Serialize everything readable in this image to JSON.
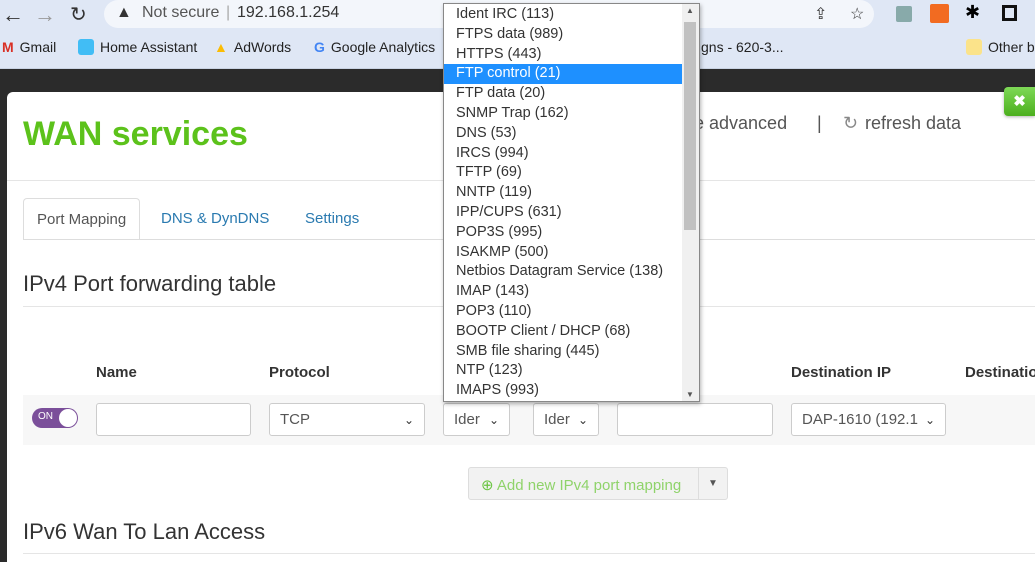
{
  "browser": {
    "security": "Not secure",
    "url": "192.168.1.254",
    "bookmarks": [
      "Gmail",
      "Home Assistant",
      "AdWords",
      "Google Analytics",
      "gns - 620-3...",
      "Other b"
    ]
  },
  "header": {
    "title": "WAN services",
    "toggle_advanced": "le advanced",
    "separator": "|",
    "refresh": "refresh data",
    "close": "✖"
  },
  "tabs": [
    "Port Mapping",
    "DNS & DynDNS",
    "Settings"
  ],
  "ipv4": {
    "heading": "IPv4 Port forwarding table",
    "columns": [
      "Name",
      "Protocol",
      "Destination IP",
      "Destinatio"
    ],
    "row": {
      "toggle": "ON",
      "name": "",
      "protocol": "TCP",
      "ext_port": "Ider",
      "int_port": "Ider",
      "other": "",
      "dest_ip": "DAP-1610 (192.1"
    },
    "add_button": "Add new IPv4 port mapping"
  },
  "ipv6": {
    "heading": "IPv6 Wan To Lan Access"
  },
  "dropdown": {
    "selected": "FTP control (21)",
    "options": [
      "Ident IRC (113)",
      "FTPS data (989)",
      "HTTPS (443)",
      "FTP control (21)",
      "FTP data (20)",
      "SNMP Trap (162)",
      "DNS (53)",
      "IRCS (994)",
      "TFTP (69)",
      "NNTP (119)",
      "IPP/CUPS (631)",
      "POP3S (995)",
      "ISAKMP (500)",
      "Netbios Datagram Service (138)",
      "IMAP (143)",
      "POP3 (110)",
      "BOOTP Client / DHCP (68)",
      "SMB file sharing (445)",
      "NTP (123)",
      "IMAPS (993)"
    ]
  },
  "colors": {
    "accent": "#5cc21b",
    "link": "#2a7ab0",
    "selection": "#1e90ff",
    "toggle": "#7b4f9a"
  }
}
